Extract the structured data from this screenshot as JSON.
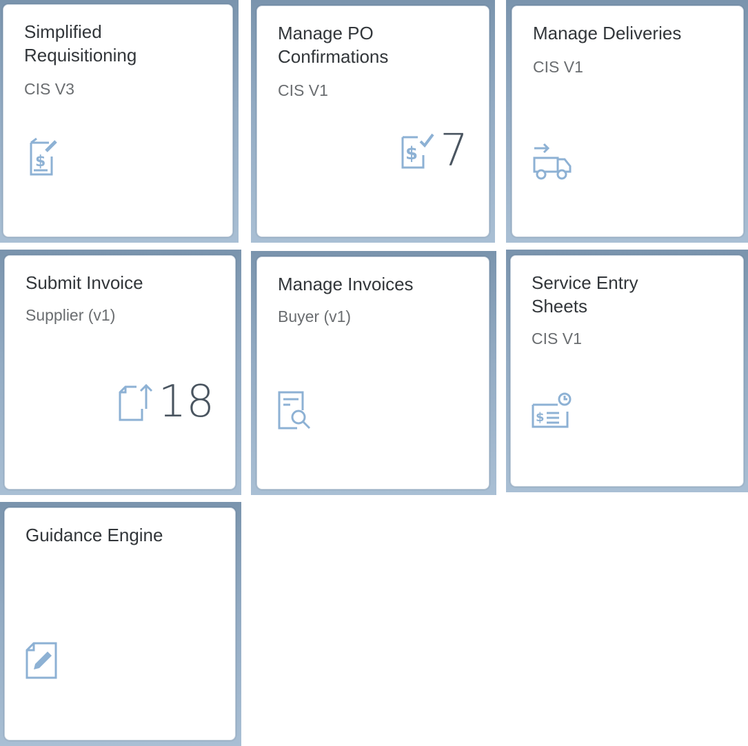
{
  "tiles": [
    {
      "title": "Simplified Requisitioning",
      "subtitle": "CIS V3",
      "icon": "requisition-dollar-icon"
    },
    {
      "title": "Manage PO Confirmations",
      "subtitle": "CIS V1",
      "icon": "dollar-check-icon",
      "count": "7"
    },
    {
      "title": "Manage Deliveries",
      "subtitle": "CIS V1",
      "icon": "delivery-truck-icon"
    },
    {
      "title": "Submit Invoice",
      "subtitle": "Supplier (v1)",
      "icon": "upload-document-icon",
      "count": "18"
    },
    {
      "title": "Manage Invoices",
      "subtitle": "Buyer (v1)",
      "icon": "document-search-icon"
    },
    {
      "title": "Service Entry Sheets",
      "subtitle": "CIS V1",
      "icon": "service-sheet-clock-icon"
    },
    {
      "title": "Guidance Engine",
      "subtitle": "",
      "icon": "document-edit-icon"
    }
  ],
  "colors": {
    "icon": "#8db1d4",
    "kpi": "#4a5560",
    "tile_border": "#c3cfdb"
  }
}
